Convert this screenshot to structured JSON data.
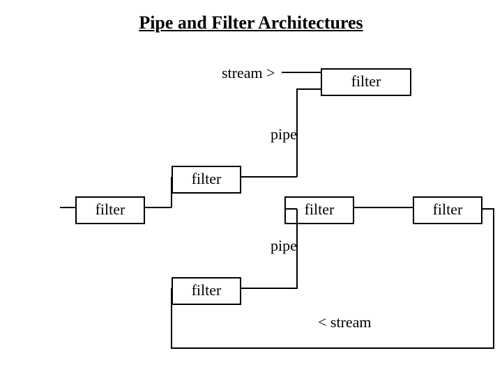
{
  "title": "Pipe and Filter Architectures",
  "labels": {
    "stream_in": "stream >",
    "pipe1": "pipe",
    "pipe2": "pipe",
    "stream_out": "< stream"
  },
  "boxes": {
    "filter_top": "filter",
    "filter_mid_upper": "filter",
    "filter_left": "filter",
    "filter_mid_center": "filter",
    "filter_right": "filter",
    "filter_low": "filter"
  }
}
